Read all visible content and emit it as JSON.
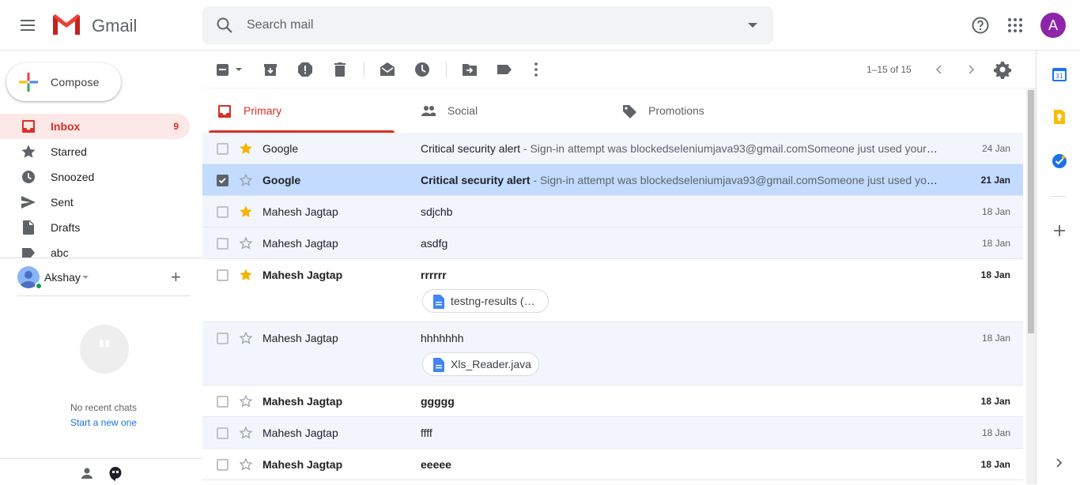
{
  "header": {
    "app_name": "Gmail",
    "search_placeholder": "Search mail",
    "avatar_letter": "A"
  },
  "sidebar": {
    "compose_label": "Compose",
    "items": [
      {
        "label": "Inbox",
        "count": "9",
        "icon": "inbox-icon",
        "active": true
      },
      {
        "label": "Starred",
        "count": "",
        "icon": "star-icon"
      },
      {
        "label": "Snoozed",
        "count": "",
        "icon": "clock-icon"
      },
      {
        "label": "Sent",
        "count": "",
        "icon": "send-icon"
      },
      {
        "label": "Drafts",
        "count": "",
        "icon": "draft-icon"
      },
      {
        "label": "abc",
        "count": "",
        "icon": "label-icon"
      }
    ]
  },
  "hangouts": {
    "user_name": "Akshay",
    "no_recent": "No recent chats",
    "start_new": "Start a new one"
  },
  "toolbar": {
    "pager": "1–15 of 15"
  },
  "tabs": [
    {
      "label": "Primary",
      "icon": "inbox-icon",
      "active": true
    },
    {
      "label": "Social",
      "icon": "people-icon"
    },
    {
      "label": "Promotions",
      "icon": "tag-icon"
    }
  ],
  "emails": [
    {
      "sender": "Google",
      "subject": "Critical security alert",
      "preview": " - Sign-in attempt was blockedseleniumjava93@gmail.comSomeone just used your password to try to sign in to your account",
      "date": "24 Jan",
      "starred": true,
      "unread": false,
      "selected": false
    },
    {
      "sender": "Google",
      "subject": "Critical security alert",
      "preview": " - Sign-in attempt was blockedseleniumjava93@gmail.comSomeone just used your password to try to sign in to your account",
      "date": "21 Jan",
      "starred": false,
      "unread": true,
      "selected": true
    },
    {
      "sender": "Mahesh Jagtap",
      "subject": "sdjchb",
      "preview": "",
      "date": "18 Jan",
      "starred": true,
      "unread": false,
      "selected": false
    },
    {
      "sender": "Mahesh Jagtap",
      "subject": "asdfg",
      "preview": "",
      "date": "18 Jan",
      "starred": false,
      "unread": false,
      "selected": false
    },
    {
      "sender": "Mahesh Jagtap",
      "subject": "rrrrrr",
      "preview": "",
      "date": "18 Jan",
      "starred": true,
      "unread": true,
      "selected": false,
      "attachment": "testng-results (…"
    },
    {
      "sender": "Mahesh Jagtap",
      "subject": "hhhhhhh",
      "preview": "",
      "date": "18 Jan",
      "starred": false,
      "unread": false,
      "selected": false,
      "attachment": "Xls_Reader.java"
    },
    {
      "sender": "Mahesh Jagtap",
      "subject": "ggggg",
      "preview": "",
      "date": "18 Jan",
      "starred": false,
      "unread": true,
      "selected": false
    },
    {
      "sender": "Mahesh Jagtap",
      "subject": "ffff",
      "preview": "",
      "date": "18 Jan",
      "starred": false,
      "unread": false,
      "selected": false
    },
    {
      "sender": "Mahesh Jagtap",
      "subject": "eeeee",
      "preview": "",
      "date": "18 Jan",
      "starred": false,
      "unread": true,
      "selected": false
    }
  ],
  "colors": {
    "accent_red": "#d93025",
    "selected_row": "#c2dbff",
    "read_row": "#f2f6fc",
    "avatar": "#8e24aa",
    "star": "#f4b400"
  }
}
